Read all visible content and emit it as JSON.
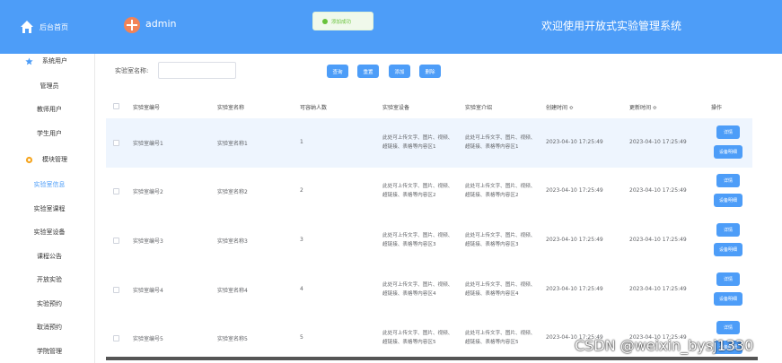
{
  "sidebar": {
    "home_label": "后台首页",
    "groups": [
      {
        "label": "系统用户",
        "icon": "star-icon"
      },
      {
        "label": "模块管理",
        "icon": "gear-icon"
      }
    ],
    "items": [
      "管理员",
      "教师用户",
      "学生用户",
      "实验室信息",
      "实验室课程",
      "实验室设备",
      "课程公告",
      "开放实验",
      "实验预约",
      "取消预约",
      "学院管理"
    ],
    "active_item": "实验室信息"
  },
  "topbar": {
    "username": "admin",
    "title": "欢迎使用开放式实验管理系统",
    "toast": "添加成功"
  },
  "search": {
    "label": "实验室名称:",
    "value": "",
    "buttons": [
      "查询",
      "重置",
      "添加",
      "删除"
    ]
  },
  "table": {
    "headers": [
      "实验室编号",
      "实验室名称",
      "可容纳人数",
      "实验室设备",
      "实验室介绍",
      "创建时间 ≎",
      "更新时间 ≎",
      "操作"
    ],
    "rows": [
      {
        "no": "实验室编号1",
        "name": "实验室名称1",
        "cap": "1",
        "equip": "此处可上传文字、图片、视频、超链接、表格等内容区1",
        "intro": "此处可上传文字、图片、视频、超链接、表格等内容区1",
        "created": "2023-04-10 17:25:49",
        "updated": "2023-04-10 17:25:49"
      },
      {
        "no": "实验室编号2",
        "name": "实验室名称2",
        "cap": "2",
        "equip": "此处可上传文字、图片、视频、超链接、表格等内容区2",
        "intro": "此处可上传文字、图片、视频、超链接、表格等内容区2",
        "created": "2023-04-10 17:25:49",
        "updated": "2023-04-10 17:25:49"
      },
      {
        "no": "实验室编号3",
        "name": "实验室名称3",
        "cap": "3",
        "equip": "此处可上传文字、图片、视频、超链接、表格等内容区3",
        "intro": "此处可上传文字、图片、视频、超链接、表格等内容区3",
        "created": "2023-04-10 17:25:49",
        "updated": "2023-04-10 17:25:49"
      },
      {
        "no": "实验室编号4",
        "name": "实验室名称4",
        "cap": "4",
        "equip": "此处可上传文字、图片、视频、超链接、表格等内容区4",
        "intro": "此处可上传文字、图片、视频、超链接、表格等内容区4",
        "created": "2023-04-10 17:25:49",
        "updated": "2023-04-10 17:25:49"
      },
      {
        "no": "实验室编号5",
        "name": "实验室名称5",
        "cap": "5",
        "equip": "此处可上传文字、图片、视频、超链接、表格等内容区5",
        "intro": "此处可上传文字、图片、视频、超链接、表格等内容区5",
        "created": "2023-04-10 17:25:49",
        "updated": "2023-04-10 17:25:49"
      }
    ],
    "row_actions": [
      "详情",
      "设备明细"
    ]
  },
  "watermark": "CSDN @weixin_bysj1330",
  "colors": {
    "primary": "#4d9df8",
    "success": "#67c23a",
    "highlight": "#eef5fe"
  }
}
